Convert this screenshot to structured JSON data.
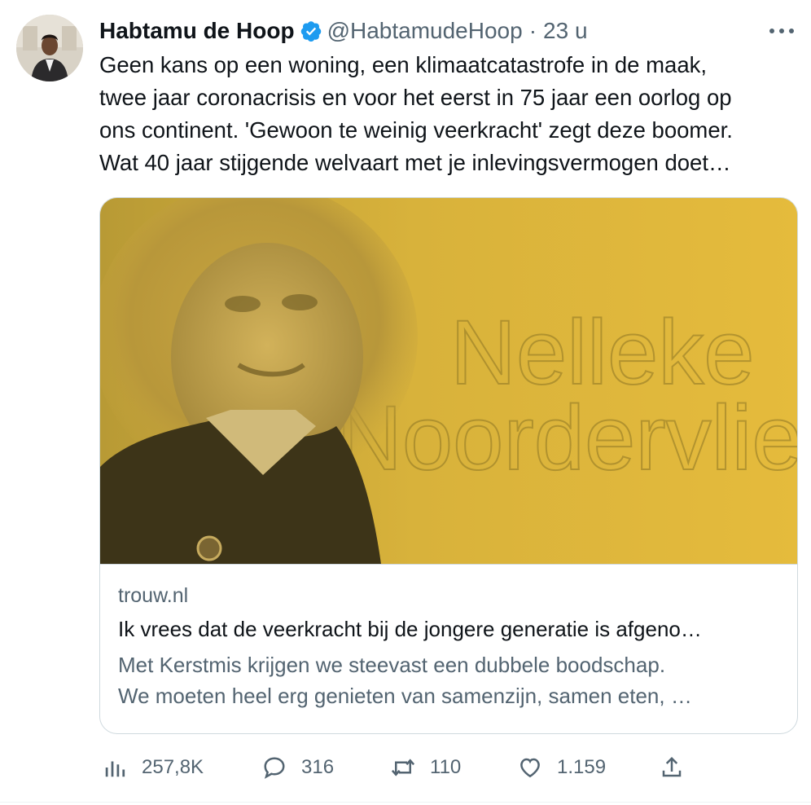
{
  "author": {
    "name": "Habtamu de Hoop",
    "handle": "@HabtamudeHoop",
    "separator": "·",
    "time": "23 u",
    "verified": true,
    "avatar_icon": "profile-photo"
  },
  "more_icon": "ellipsis-icon",
  "more_label": "···",
  "tweet": {
    "lines": [
      "Geen kans op een woning, een klimaatcatastrofe in de maak,",
      "twee jaar coronacrisis en voor het eerst in 75 jaar een oorlog op",
      "ons continent. 'Gewoon te weinig veerkracht' zegt deze boomer.",
      "Wat 40 jaar stijgende welvaart met je inlevingsvermogen doet…"
    ]
  },
  "card": {
    "image_text_1": "Nelleke",
    "image_text_2": "Noordervliet",
    "image_bg": "#e3b83a",
    "domain": "trouw.nl",
    "title": "Ik vrees dat de veerkracht bij de jongere generatie is afgeno…",
    "description": [
      "Met Kerstmis krijgen we steevast een dubbele boodschap.",
      "We moeten heel erg genieten van samenzijn, samen eten, …"
    ]
  },
  "actions": {
    "views": "257,8K",
    "replies": "316",
    "retweets": "110",
    "likes": "1.159"
  },
  "colors": {
    "text": "#0f1419",
    "muted": "#536471",
    "verified": "#1d9bf0",
    "border": "#cfd9de"
  }
}
